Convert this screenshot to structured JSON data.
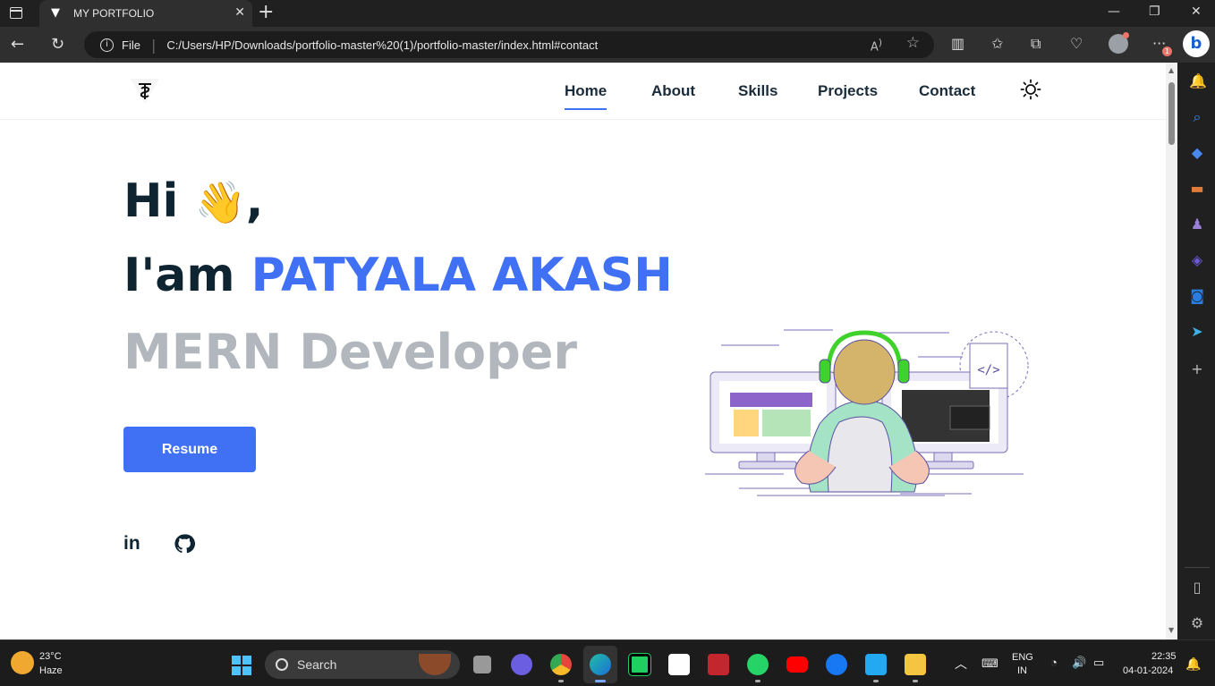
{
  "browser": {
    "tab_title": "MY PORTFOLIO",
    "new_tab_symbol": "+",
    "scheme_label": "File",
    "url": "C:/Users/HP/Downloads/portfolio-master%20(1)/portfolio-master/index.html#contact",
    "notification_badge": "1"
  },
  "page": {
    "nav": {
      "home": "Home",
      "about": "About",
      "skills": "Skills",
      "projects": "Projects",
      "contact": "Contact",
      "active": "Home"
    },
    "hero": {
      "greeting": "Hi",
      "wave_emoji": "👋",
      "comma": ",",
      "iam": "I'am",
      "name": "PATYALA AKASH",
      "role": "MERN Developer",
      "resume_label": "Resume"
    },
    "social": {
      "linkedin": "in"
    },
    "illustration_code_tag": "</>",
    "colors": {
      "accent": "#4070f4",
      "heading": "#0e2431",
      "muted": "#b2b7bd"
    }
  },
  "taskbar": {
    "temperature": "23°C",
    "weather": "Haze",
    "search_label": "Search",
    "lang_top": "ENG",
    "lang_bottom": "IN",
    "time": "22:35",
    "date": "04-01-2024"
  }
}
